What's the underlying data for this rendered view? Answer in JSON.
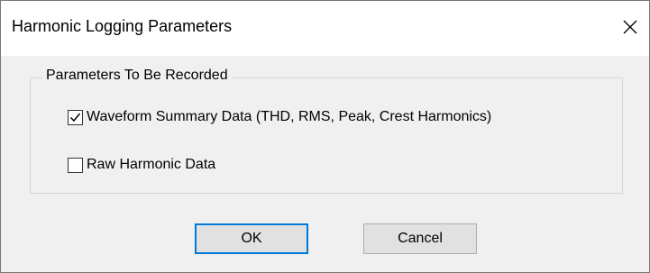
{
  "window": {
    "title": "Harmonic Logging Parameters",
    "close_icon": "close-icon"
  },
  "group": {
    "legend": "Parameters To Be Recorded",
    "options": [
      {
        "label": "Waveform Summary Data (THD, RMS, Peak, Crest Harmonics)",
        "checked": true
      },
      {
        "label": "Raw Harmonic Data",
        "checked": false
      }
    ]
  },
  "buttons": {
    "ok_label": "OK",
    "cancel_label": "Cancel"
  },
  "colors": {
    "default_button_border": "#0078d7",
    "dialog_background": "#f0f0f0"
  }
}
